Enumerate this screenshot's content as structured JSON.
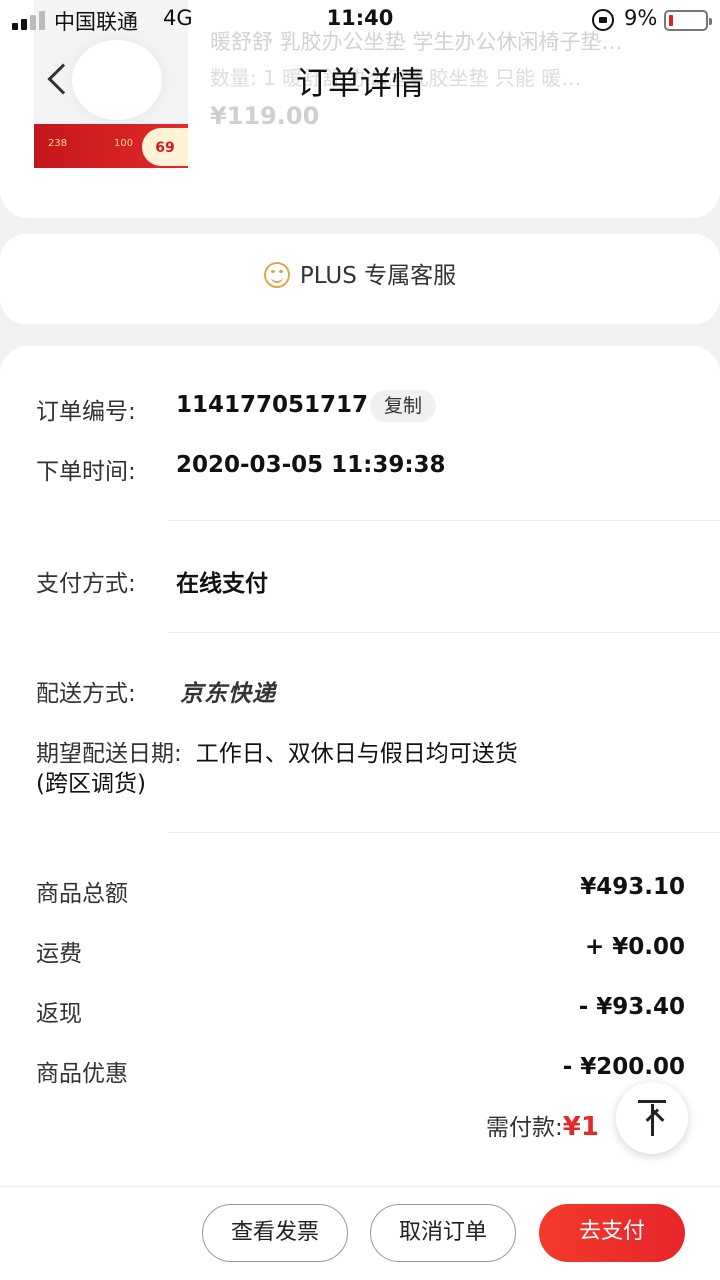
{
  "status_bar": {
    "carrier": "中国联通",
    "network": "4G",
    "time": "11:40",
    "battery_percent": "9%"
  },
  "header": {
    "title": "订单详情",
    "back_icon": "chevron-left-icon"
  },
  "product": {
    "title": "暖舒舒 乳胶办公坐垫 学生办公休闲椅子垫…",
    "spec": "数量: 1   暖舒舒 办公室乳胶坐垫 只能 暖…",
    "price": "¥119.00",
    "promo_price_a": "238",
    "promo_price_b": "100",
    "promo_badge": "69"
  },
  "plus_service": {
    "label": "PLUS 专属客服",
    "icon": "smile-chat-icon",
    "icon_color": "#d9a94a"
  },
  "order_info": {
    "order_no_label": "订单编号:",
    "order_no": "114177051717",
    "copy_label": "复制",
    "order_time_label": "下单时间:",
    "order_time": "2020-03-05 11:39:38",
    "payment_label": "支付方式:",
    "payment": "在线支付",
    "delivery_label": "配送方式:",
    "delivery": "京东快递",
    "expected_label": "期望配送日期:",
    "expected": "工作日、双休日与假日均可送货",
    "expected_note": "(跨区调货)"
  },
  "summary": {
    "items": [
      {
        "label": "商品总额",
        "value": "¥493.10"
      },
      {
        "label": "运费",
        "value": "+ ¥0.00"
      },
      {
        "label": "返现",
        "value": "- ¥93.40"
      },
      {
        "label": "商品优惠",
        "value": "- ¥200.00"
      }
    ],
    "need_pay_label": "需付款:",
    "need_pay_amount": "¥1",
    "accent_color": "#e5292b"
  },
  "actions": {
    "invoice": "查看发票",
    "cancel": "取消订单",
    "pay": "去支付"
  }
}
